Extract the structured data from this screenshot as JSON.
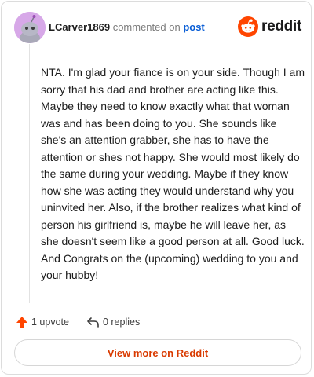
{
  "header": {
    "username": "LCarver1869",
    "commented_on": "commented on",
    "post_link": "post",
    "brand_name": "reddit",
    "brand_color": "#ff4500"
  },
  "comment": {
    "text": "NTA. I'm glad your fiance is on your side. Though I am sorry that his dad and brother are acting like this. Maybe they need to know exactly what that woman was and has been doing to you. She sounds like she's an attention grabber, she has to have the attention or shes not happy. She would most likely do the same during your wedding. Maybe if they know how she was acting they would understand why you uninvited her. Also, if the brother realizes what kind of person his girlfriend is, maybe he will leave her, as she doesn't seem like a good person at all. Good luck. And Congrats on the (upcoming) wedding to you and your hubby!"
  },
  "actions": {
    "upvote_label": "1 upvote",
    "replies_label": "0 replies"
  },
  "footer": {
    "view_more_label": "View more on Reddit"
  },
  "icons": {
    "avatar": "snoo-avatar",
    "brand_logo": "reddit-snoo-icon",
    "upvote": "upvote-arrow-icon",
    "reply": "reply-arrow-icon"
  }
}
